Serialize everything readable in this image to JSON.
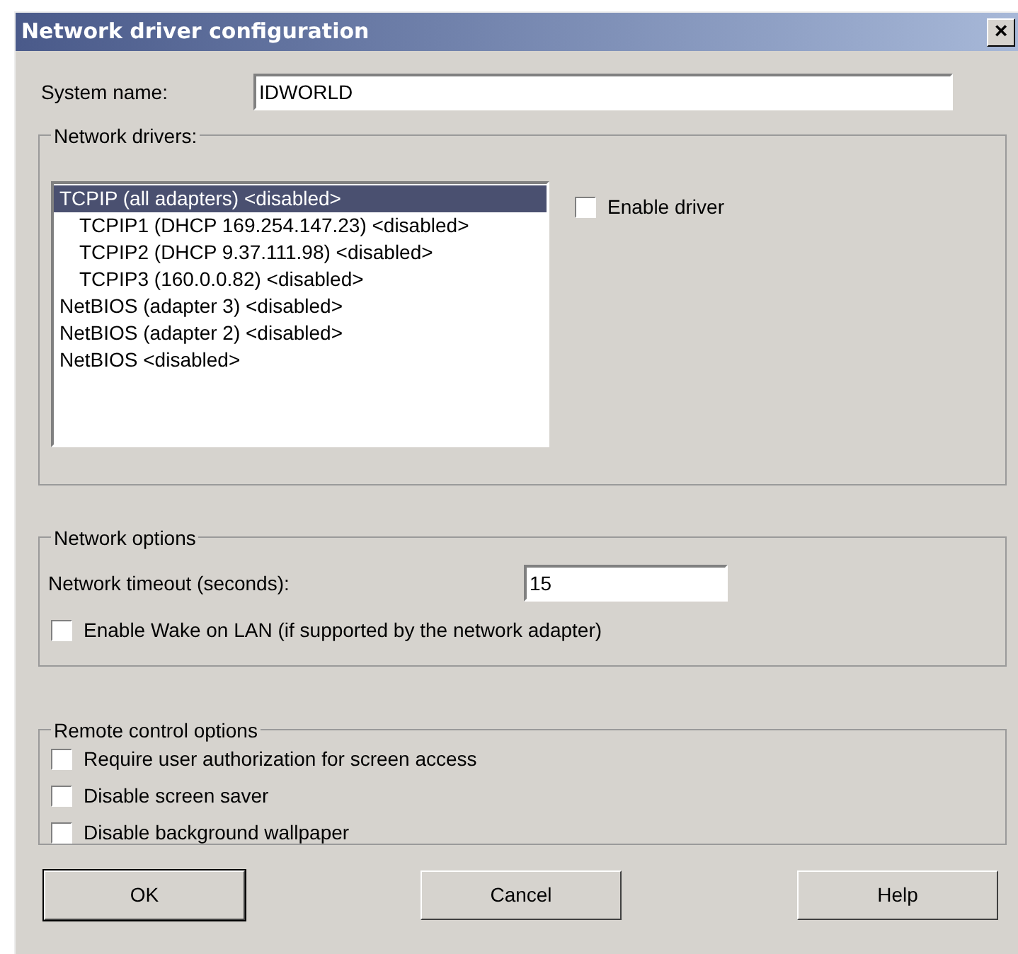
{
  "window": {
    "title": "Network driver configuration",
    "close": "×"
  },
  "system_name": {
    "label": "System name:",
    "value": "IDWORLD"
  },
  "network_drivers": {
    "title": "Network drivers:",
    "items": [
      {
        "label": "TCPIP (all adapters) <disabled>",
        "selected": true,
        "children": [
          {
            "label": "TCPIP1 (DHCP 169.254.147.23) <disabled>",
            "selected": false
          },
          {
            "label": "TCPIP2 (DHCP 9.37.111.98) <disabled>",
            "selected": false
          },
          {
            "label": "TCPIP3 (160.0.0.82) <disabled>",
            "selected": false
          }
        ]
      },
      {
        "label": "NetBIOS (adapter 3) <disabled>",
        "selected": false
      },
      {
        "label": "NetBIOS (adapter 2) <disabled>",
        "selected": false
      },
      {
        "label": "NetBIOS <disabled>",
        "selected": false
      }
    ],
    "enable_driver": {
      "label": "Enable driver",
      "checked": false
    }
  },
  "network_options": {
    "title": "Network options",
    "timeout_label": "Network timeout (seconds):",
    "timeout_value": "15",
    "wake_on_lan": {
      "label": "Enable Wake on LAN (if supported by the network adapter)",
      "checked": false
    }
  },
  "remote_control_options": {
    "title": "Remote control options",
    "options": [
      {
        "label": "Require user authorization for screen access",
        "checked": false
      },
      {
        "label": "Disable screen saver",
        "checked": false
      },
      {
        "label": "Disable background wallpaper",
        "checked": false
      }
    ]
  },
  "buttons": [
    {
      "label": "OK",
      "default": true
    },
    {
      "label": "Cancel",
      "default": false
    },
    {
      "label": "Help",
      "default": false
    }
  ]
}
